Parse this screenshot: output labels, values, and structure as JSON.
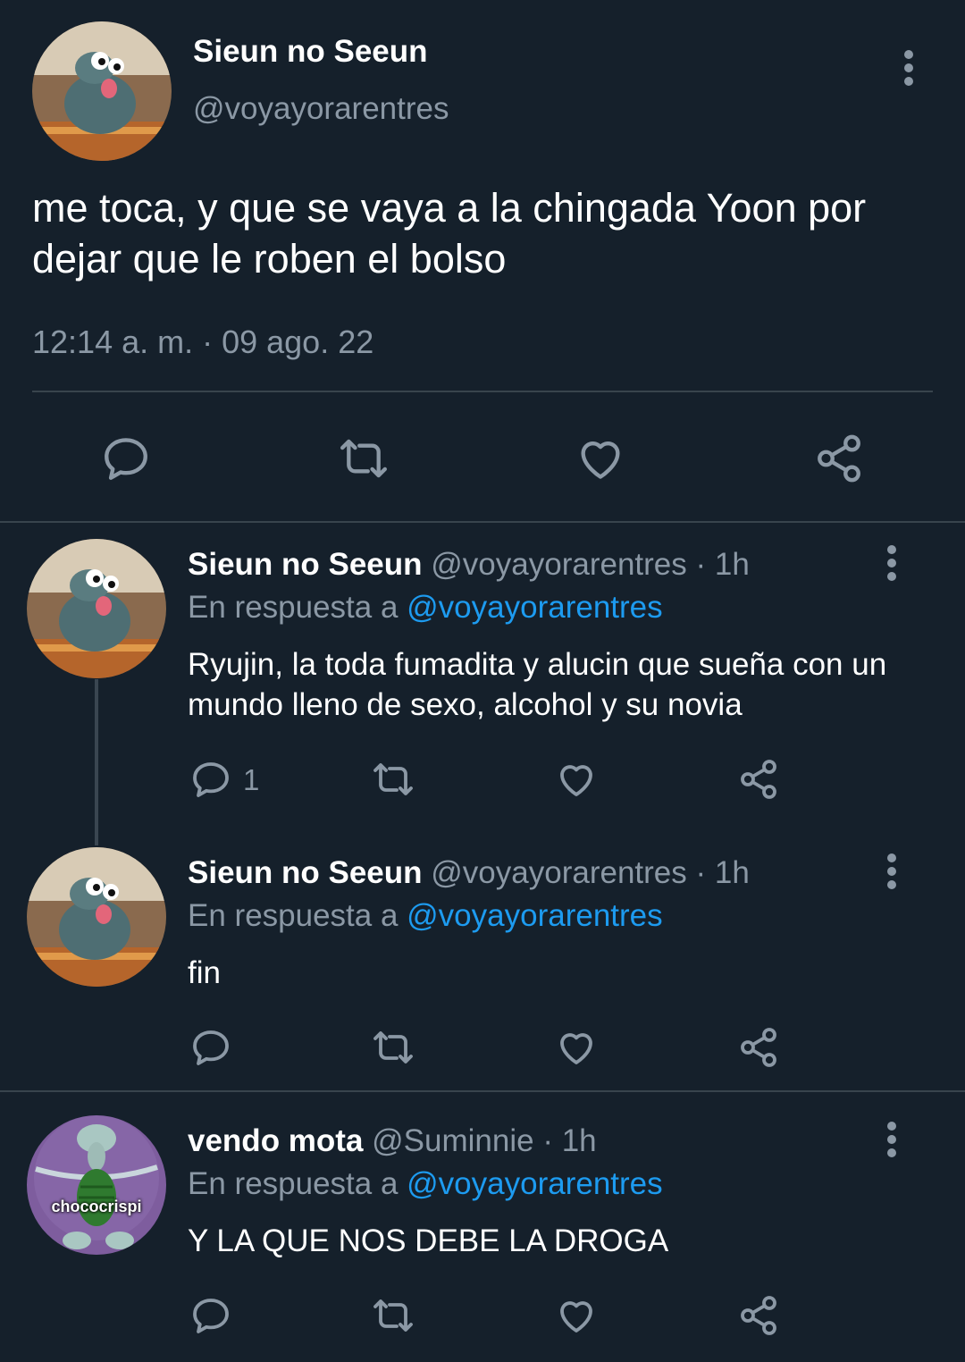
{
  "main_tweet": {
    "name": "Sieun no Seeun",
    "handle": "@voyayorarentres",
    "text": "me toca, y que se vaya a la chingada Yoon por dejar que le roben el bolso",
    "timestamp": "12:14 a. m. · 09 ago. 22",
    "avatar": "cartoon-mouse-avatar",
    "actions": [
      "reply-icon",
      "retweet-icon",
      "like-icon",
      "share-icon"
    ]
  },
  "replies": [
    {
      "name": "Sieun no Seeun",
      "handle": "@voyayorarentres",
      "sep_time": " · 1h",
      "reply_prefix": "En respuesta a ",
      "reply_to": "@voyayorarentres",
      "text": "Ryujin, la toda fumadita y alucin que sueña con un mundo lleno de sexo, alcohol y su novia",
      "reply_count": "1",
      "avatar": "cartoon-mouse-avatar"
    },
    {
      "name": "Sieun no Seeun",
      "handle": "@voyayorarentres",
      "sep_time": " · 1h",
      "reply_prefix": "En respuesta a ",
      "reply_to": "@voyayorarentres",
      "text": "fin",
      "reply_count": "",
      "avatar": "cartoon-mouse-avatar"
    },
    {
      "name": "vendo mota",
      "handle": "@Suminnie",
      "sep_time": " · 1h",
      "reply_prefix": "En respuesta a ",
      "reply_to": "@voyayorarentres",
      "text": "Y LA QUE NOS DEBE LA DROGA",
      "reply_count": "",
      "avatar": "squidward-avatar",
      "avatar_caption": "chococrispi"
    }
  ],
  "colors": {
    "background": "#15202b",
    "text": "#ffffff",
    "muted": "#8b98a5",
    "link": "#1d9bf0",
    "divider": "#38444d"
  }
}
